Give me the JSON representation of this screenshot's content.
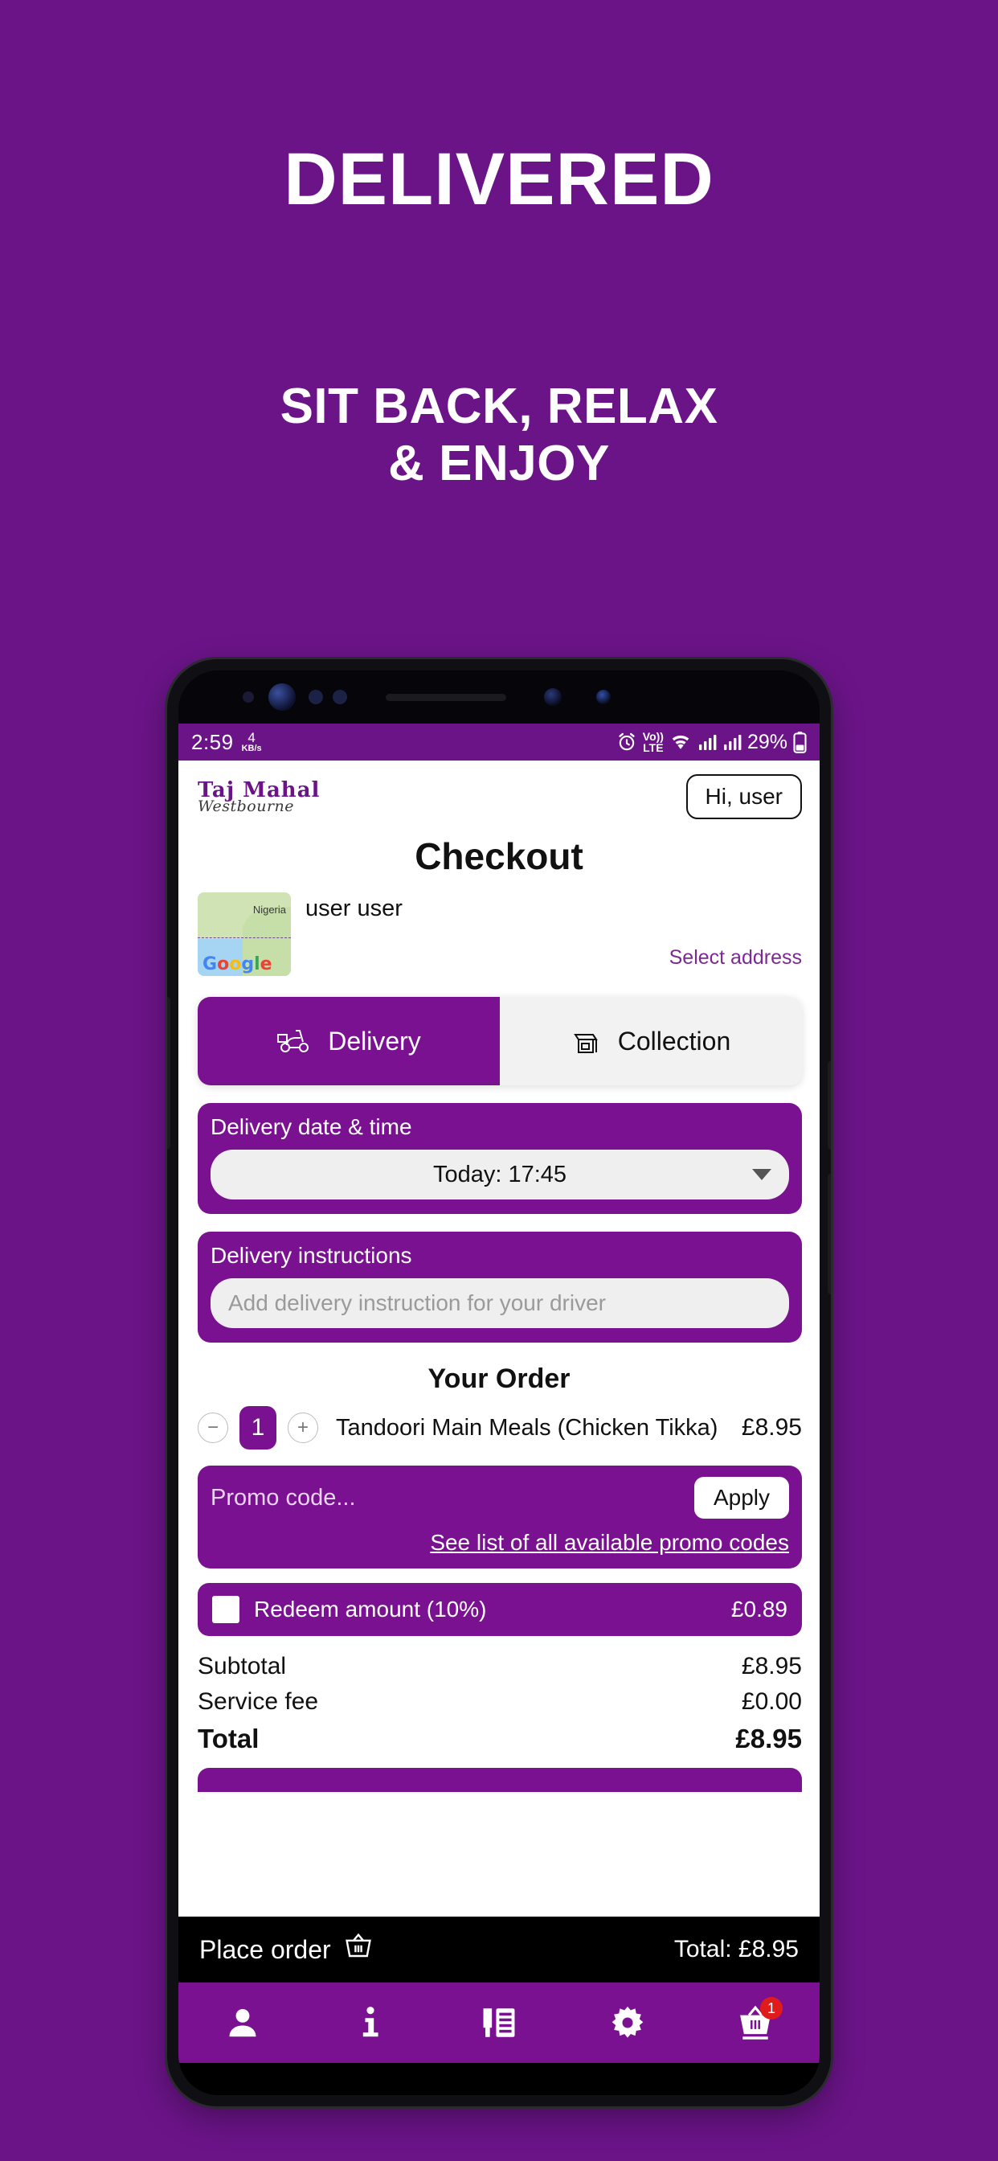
{
  "promo_banner": {
    "headline": "DELIVERED",
    "subheadline_line1": "SIT BACK, RELAX",
    "subheadline_line2": "& ENJOY",
    "background_color": "#6B1488",
    "text_color": "#FFFFFF"
  },
  "status_bar": {
    "time": "2:59",
    "data_rate_value": "4",
    "data_rate_unit": "KB/s",
    "alarm_icon": "alarm-icon",
    "volte_line1": "Vo))",
    "volte_line2": "LTE",
    "wifi_icon": "wifi-icon",
    "signal_icon_1": "signal-bars-icon",
    "signal_icon_2": "signal-bars-icon",
    "battery_percent": "29%",
    "battery_icon": "battery-icon"
  },
  "app_header": {
    "logo_line1": "Taj Mahal",
    "logo_line2": "Westbourne",
    "account_button": "Hi, user"
  },
  "page_title": "Checkout",
  "address": {
    "map_label": "Nigeria",
    "map_attribution": "Google",
    "customer_name": "user user",
    "select_address_link": "Select address"
  },
  "mode_tabs": [
    {
      "label": "Delivery",
      "icon": "scooter-icon",
      "active": true
    },
    {
      "label": "Collection",
      "icon": "shop-icon",
      "active": false
    }
  ],
  "delivery_datetime": {
    "label": "Delivery date & time",
    "selected_value": "Today: 17:45",
    "dropdown_icon": "chevron-down-icon"
  },
  "delivery_instructions": {
    "label": "Delivery instructions",
    "placeholder": "Add delivery instruction for your driver",
    "value": ""
  },
  "order": {
    "title": "Your Order",
    "items": [
      {
        "quantity": "1",
        "name": "Tandoori Main Meals (Chicken Tikka)",
        "price": "£8.95",
        "decrease_label": "−",
        "increase_label": "+"
      }
    ]
  },
  "promo": {
    "placeholder": "Promo code...",
    "value": "",
    "apply_label": "Apply",
    "list_link": "See list of all available promo codes"
  },
  "redeem": {
    "label": "Redeem amount (10%)",
    "amount": "£0.89",
    "checked": false
  },
  "totals": [
    {
      "label": "Subtotal",
      "value": "£8.95"
    },
    {
      "label": "Service fee",
      "value": "£0.00"
    },
    {
      "label": "Total",
      "value": "£8.95"
    }
  ],
  "place_order_bar": {
    "label": "Place order",
    "basket_icon": "basket-icon",
    "total_label": "Total: £8.95"
  },
  "bottom_nav": [
    {
      "name": "account",
      "icon": "person-icon",
      "badge": ""
    },
    {
      "name": "info",
      "icon": "info-icon",
      "badge": ""
    },
    {
      "name": "menu",
      "icon": "menu-book-icon",
      "badge": ""
    },
    {
      "name": "settings",
      "icon": "gear-icon",
      "badge": ""
    },
    {
      "name": "basket",
      "icon": "basket-icon",
      "badge": "1"
    }
  ],
  "theme": {
    "brand_purple": "#7A1191",
    "banner_purple": "#6B1488",
    "accent_link": "#7B2A94",
    "badge_red": "#E01B1B"
  }
}
